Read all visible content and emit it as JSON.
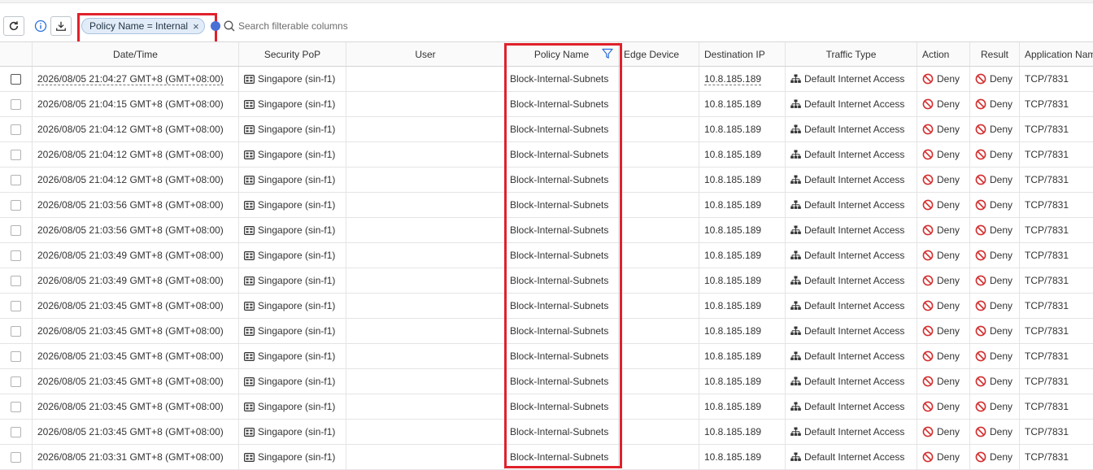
{
  "toolbar": {
    "filter_chip": "Policy Name = Internal",
    "filter_chip_close": "×",
    "search_placeholder": "Search filterable columns"
  },
  "columns": [
    "Date/Time",
    "Security PoP",
    "User",
    "Policy Name",
    "Edge Device",
    "Destination IP",
    "Traffic Type",
    "Action",
    "Result",
    "Application Name"
  ],
  "rows": [
    {
      "datetime": "2026/08/05 21:04:27 GMT+8 (GMT+08:00)",
      "pop": "Singapore (sin-f1)",
      "user": "",
      "policy": "Block-Internal-Subnets",
      "edge": "",
      "dest_ip": "10.8.185.189",
      "traffic": "Default Internet Access",
      "action": "Deny",
      "result": "Deny",
      "app": "TCP/7831"
    },
    {
      "datetime": "2026/08/05 21:04:15 GMT+8 (GMT+08:00)",
      "pop": "Singapore (sin-f1)",
      "user": "",
      "policy": "Block-Internal-Subnets",
      "edge": "",
      "dest_ip": "10.8.185.189",
      "traffic": "Default Internet Access",
      "action": "Deny",
      "result": "Deny",
      "app": "TCP/7831"
    },
    {
      "datetime": "2026/08/05 21:04:12 GMT+8 (GMT+08:00)",
      "pop": "Singapore (sin-f1)",
      "user": "",
      "policy": "Block-Internal-Subnets",
      "edge": "",
      "dest_ip": "10.8.185.189",
      "traffic": "Default Internet Access",
      "action": "Deny",
      "result": "Deny",
      "app": "TCP/7831"
    },
    {
      "datetime": "2026/08/05 21:04:12 GMT+8 (GMT+08:00)",
      "pop": "Singapore (sin-f1)",
      "user": "",
      "policy": "Block-Internal-Subnets",
      "edge": "",
      "dest_ip": "10.8.185.189",
      "traffic": "Default Internet Access",
      "action": "Deny",
      "result": "Deny",
      "app": "TCP/7831"
    },
    {
      "datetime": "2026/08/05 21:04:12 GMT+8 (GMT+08:00)",
      "pop": "Singapore (sin-f1)",
      "user": "",
      "policy": "Block-Internal-Subnets",
      "edge": "",
      "dest_ip": "10.8.185.189",
      "traffic": "Default Internet Access",
      "action": "Deny",
      "result": "Deny",
      "app": "TCP/7831"
    },
    {
      "datetime": "2026/08/05 21:03:56 GMT+8 (GMT+08:00)",
      "pop": "Singapore (sin-f1)",
      "user": "",
      "policy": "Block-Internal-Subnets",
      "edge": "",
      "dest_ip": "10.8.185.189",
      "traffic": "Default Internet Access",
      "action": "Deny",
      "result": "Deny",
      "app": "TCP/7831"
    },
    {
      "datetime": "2026/08/05 21:03:56 GMT+8 (GMT+08:00)",
      "pop": "Singapore (sin-f1)",
      "user": "",
      "policy": "Block-Internal-Subnets",
      "edge": "",
      "dest_ip": "10.8.185.189",
      "traffic": "Default Internet Access",
      "action": "Deny",
      "result": "Deny",
      "app": "TCP/7831"
    },
    {
      "datetime": "2026/08/05 21:03:49 GMT+8 (GMT+08:00)",
      "pop": "Singapore (sin-f1)",
      "user": "",
      "policy": "Block-Internal-Subnets",
      "edge": "",
      "dest_ip": "10.8.185.189",
      "traffic": "Default Internet Access",
      "action": "Deny",
      "result": "Deny",
      "app": "TCP/7831"
    },
    {
      "datetime": "2026/08/05 21:03:49 GMT+8 (GMT+08:00)",
      "pop": "Singapore (sin-f1)",
      "user": "",
      "policy": "Block-Internal-Subnets",
      "edge": "",
      "dest_ip": "10.8.185.189",
      "traffic": "Default Internet Access",
      "action": "Deny",
      "result": "Deny",
      "app": "TCP/7831"
    },
    {
      "datetime": "2026/08/05 21:03:45 GMT+8 (GMT+08:00)",
      "pop": "Singapore (sin-f1)",
      "user": "",
      "policy": "Block-Internal-Subnets",
      "edge": "",
      "dest_ip": "10.8.185.189",
      "traffic": "Default Internet Access",
      "action": "Deny",
      "result": "Deny",
      "app": "TCP/7831"
    },
    {
      "datetime": "2026/08/05 21:03:45 GMT+8 (GMT+08:00)",
      "pop": "Singapore (sin-f1)",
      "user": "",
      "policy": "Block-Internal-Subnets",
      "edge": "",
      "dest_ip": "10.8.185.189",
      "traffic": "Default Internet Access",
      "action": "Deny",
      "result": "Deny",
      "app": "TCP/7831"
    },
    {
      "datetime": "2026/08/05 21:03:45 GMT+8 (GMT+08:00)",
      "pop": "Singapore (sin-f1)",
      "user": "",
      "policy": "Block-Internal-Subnets",
      "edge": "",
      "dest_ip": "10.8.185.189",
      "traffic": "Default Internet Access",
      "action": "Deny",
      "result": "Deny",
      "app": "TCP/7831"
    },
    {
      "datetime": "2026/08/05 21:03:45 GMT+8 (GMT+08:00)",
      "pop": "Singapore (sin-f1)",
      "user": "",
      "policy": "Block-Internal-Subnets",
      "edge": "",
      "dest_ip": "10.8.185.189",
      "traffic": "Default Internet Access",
      "action": "Deny",
      "result": "Deny",
      "app": "TCP/7831"
    },
    {
      "datetime": "2026/08/05 21:03:45 GMT+8 (GMT+08:00)",
      "pop": "Singapore (sin-f1)",
      "user": "",
      "policy": "Block-Internal-Subnets",
      "edge": "",
      "dest_ip": "10.8.185.189",
      "traffic": "Default Internet Access",
      "action": "Deny",
      "result": "Deny",
      "app": "TCP/7831"
    },
    {
      "datetime": "2026/08/05 21:03:45 GMT+8 (GMT+08:00)",
      "pop": "Singapore (sin-f1)",
      "user": "",
      "policy": "Block-Internal-Subnets",
      "edge": "",
      "dest_ip": "10.8.185.189",
      "traffic": "Default Internet Access",
      "action": "Deny",
      "result": "Deny",
      "app": "TCP/7831"
    },
    {
      "datetime": "2026/08/05 21:03:31 GMT+8 (GMT+08:00)",
      "pop": "Singapore (sin-f1)",
      "user": "",
      "policy": "Block-Internal-Subnets",
      "edge": "",
      "dest_ip": "10.8.185.189",
      "traffic": "Default Internet Access",
      "action": "Deny",
      "result": "Deny",
      "app": "TCP/7831"
    }
  ],
  "colors": {
    "highlight": "#e0212b",
    "deny_red": "#d32f2f",
    "chip_bg": "#e2ecf8",
    "accent_blue": "#2a6fdb"
  },
  "icons": {
    "refresh": "refresh-icon",
    "info": "info-icon",
    "export": "download-icon",
    "search": "search-icon",
    "filter": "filter-icon",
    "pop": "pop-icon",
    "traffic": "network-icon",
    "deny": "deny-icon"
  }
}
